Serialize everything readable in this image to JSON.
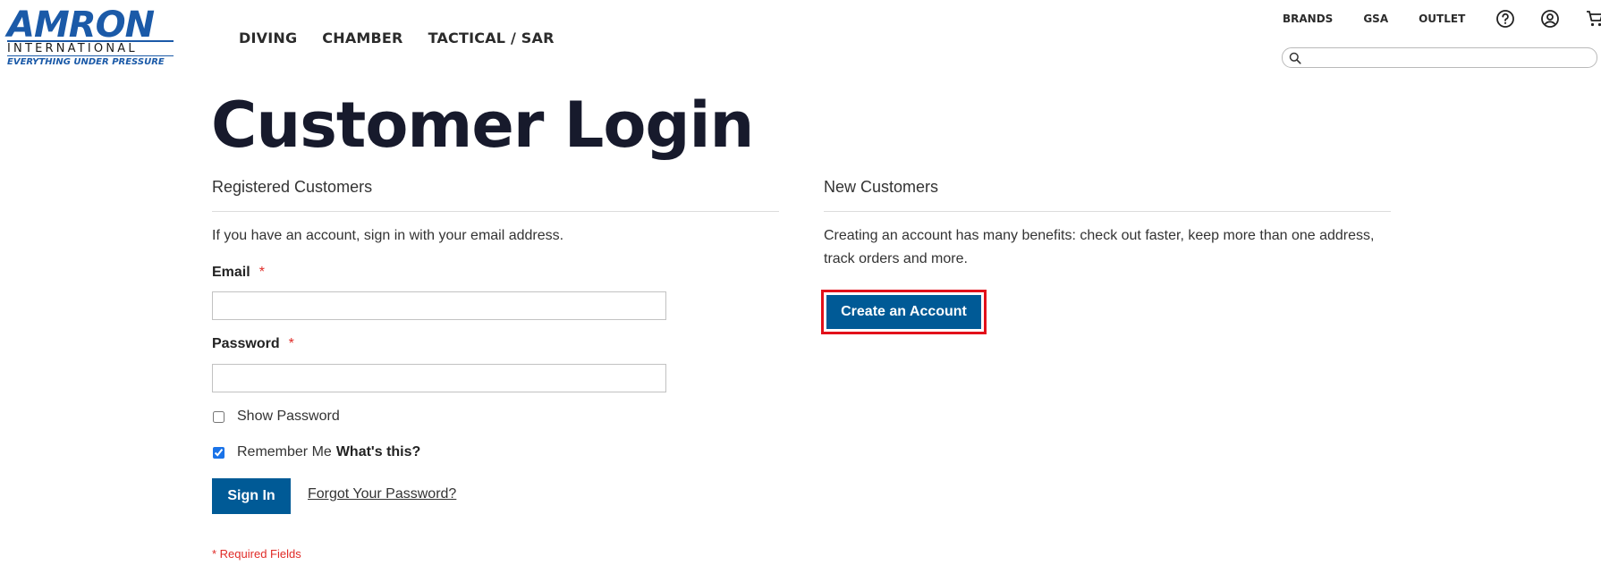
{
  "logo": {
    "main": "AMRON",
    "sub": "INTERNATIONAL",
    "tagline": "EVERYTHING UNDER PRESSURE"
  },
  "main_nav": [
    "DIVING",
    "CHAMBER",
    "TACTICAL / SAR"
  ],
  "util_nav": {
    "links": [
      "BRANDS",
      "GSA",
      "OUTLET"
    ],
    "icons": [
      "help-icon",
      "account-icon",
      "cart-icon"
    ]
  },
  "search": {
    "placeholder": "",
    "value": ""
  },
  "page_title": "Customer Login",
  "registered": {
    "title": "Registered Customers",
    "intro": "If you have an account, sign in with your email address.",
    "email_label": "Email",
    "email_value": "",
    "password_label": "Password",
    "password_value": "",
    "required_mark": "*",
    "show_password": "Show Password",
    "remember_me": "Remember Me",
    "whats_this": "What's this?",
    "sign_in": "Sign In",
    "forgot": "Forgot Your Password?",
    "required_fields": "* Required Fields"
  },
  "new_customers": {
    "title": "New Customers",
    "line1": "Creating an account has many benefits: check out faster, keep more than one address,",
    "line2": "track orders and more.",
    "create_button": "Create an Account"
  },
  "colors": {
    "primary_button": "#005a96",
    "logo_blue": "#1b5aa8",
    "required_red": "#e02b27",
    "highlight_border": "#e2101a"
  }
}
